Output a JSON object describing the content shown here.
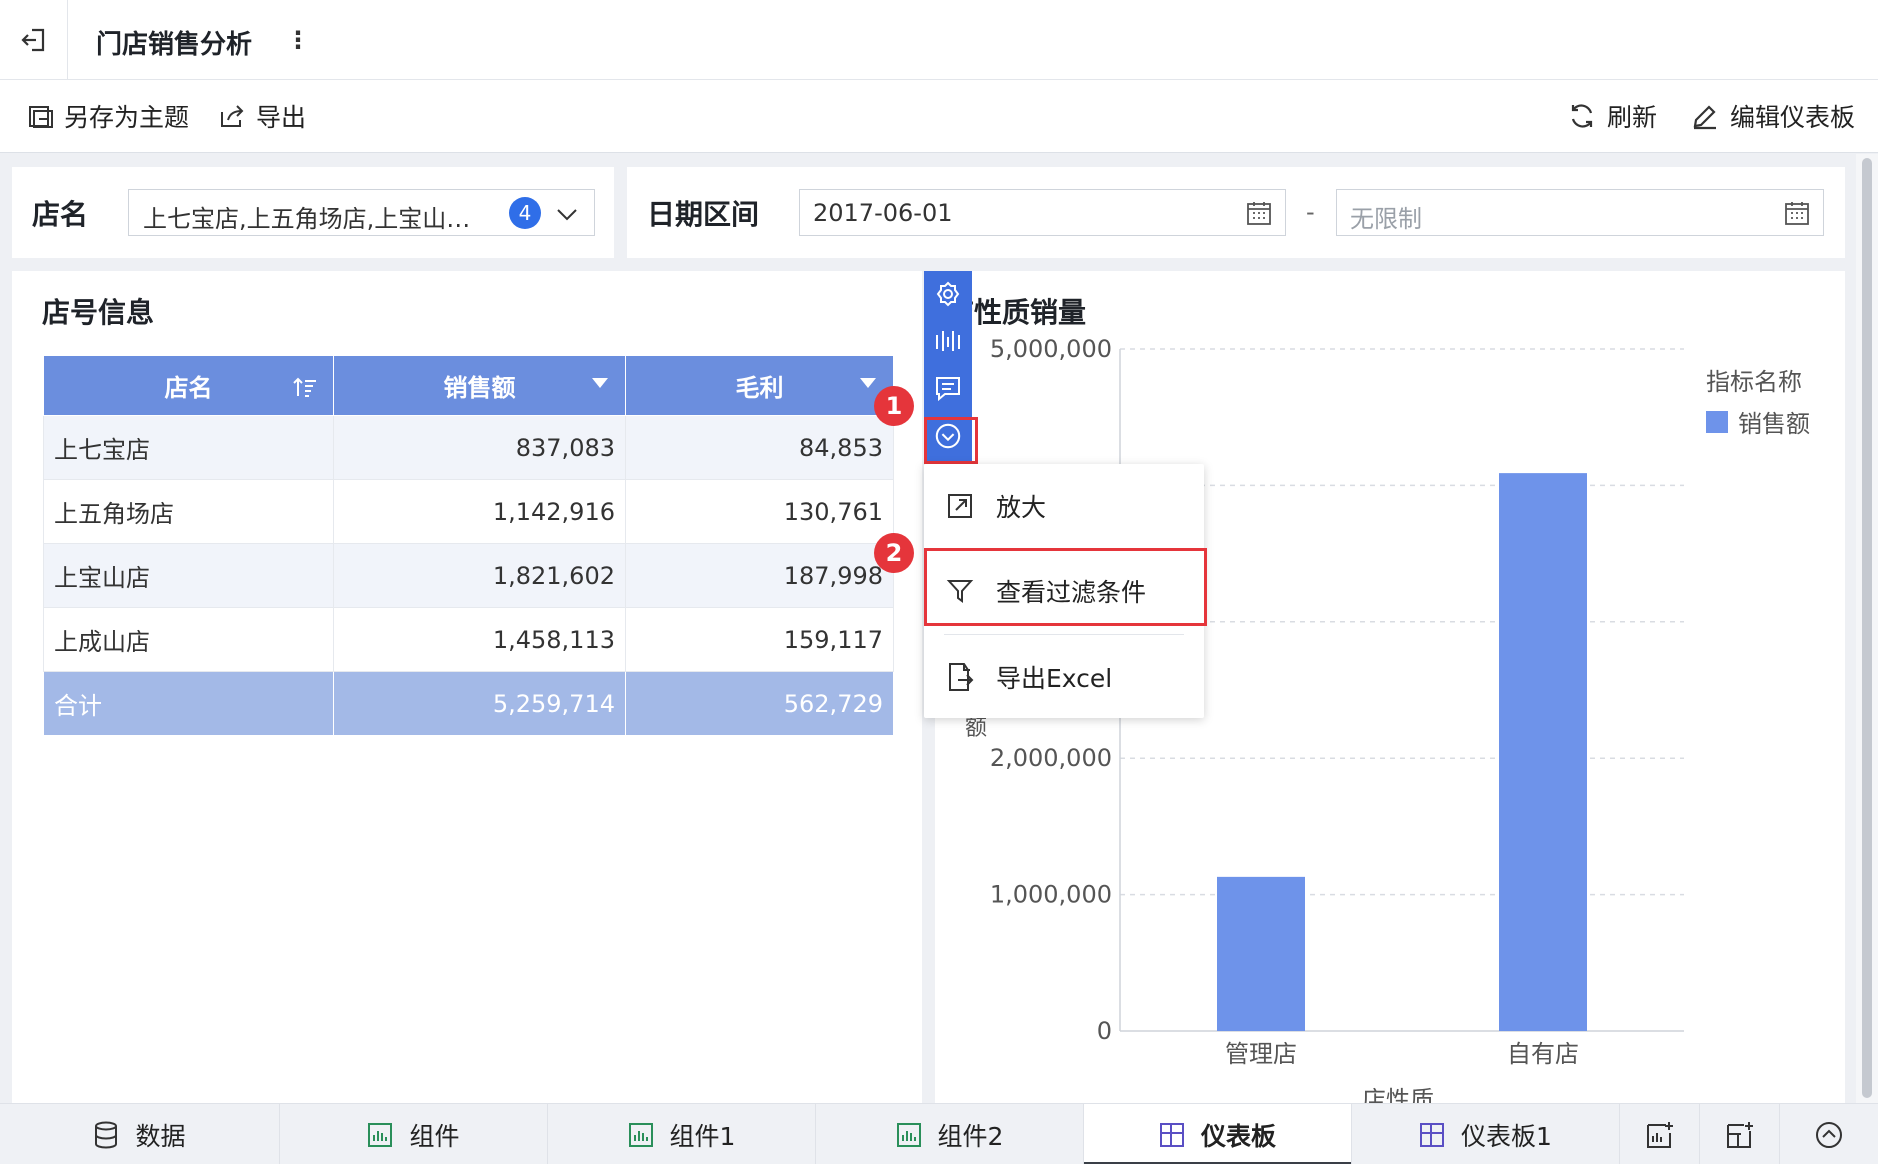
{
  "header": {
    "title": "门店销售分析",
    "more": "⋮"
  },
  "toolbar": {
    "save_as_theme": "另存为主题",
    "export": "导出",
    "refresh": "刷新",
    "edit_dashboard": "编辑仪表板"
  },
  "filters": {
    "store": {
      "label": "店名",
      "value": "上七宝店,上五角场店,上宝山…",
      "count": "4"
    },
    "date": {
      "label": "日期区间",
      "start": "2017-06-01",
      "separator": "-",
      "end_placeholder": "无限制"
    }
  },
  "table_widget": {
    "title": "店号信息",
    "columns": [
      "店名",
      "销售额",
      "毛利"
    ],
    "rows": [
      [
        "上七宝店",
        "837,083",
        "84,853"
      ],
      [
        "上五角场店",
        "1,142,916",
        "130,761"
      ],
      [
        "上宝山店",
        "1,821,602",
        "187,998"
      ],
      [
        "上成山店",
        "1,458,113",
        "159,117"
      ]
    ],
    "total": [
      "合计",
      "5,259,714",
      "562,729"
    ]
  },
  "chart_widget": {
    "title": "店性质销量",
    "title_visible": "店性质销量"
  },
  "chart_data": {
    "type": "bar",
    "categories": [
      "管理店",
      "自有店"
    ],
    "series": [
      {
        "name": "销售额",
        "values": [
          1130000,
          4090000
        ]
      }
    ],
    "yticks": [
      "0",
      "1,000,000",
      "2,000,000",
      "5,000,000"
    ],
    "ylim": [
      0,
      5000000
    ],
    "xlabel": "店性质",
    "ylabel_visible": "额",
    "legend_title": "指标名称",
    "legend_position": "top-right",
    "grid": true,
    "bar_color": "#6e93ea"
  },
  "context_menu": {
    "zoom": "放大",
    "view_filters": "查看过滤条件",
    "export_excel": "导出Excel"
  },
  "markers": {
    "m1": "1",
    "m2": "2"
  },
  "bottom_tabs": [
    {
      "label": "数据"
    },
    {
      "label": "组件"
    },
    {
      "label": "组件1"
    },
    {
      "label": "组件2"
    },
    {
      "label": "仪表板"
    },
    {
      "label": "仪表板1"
    }
  ],
  "colors": {
    "accent": "#3f6fdd",
    "header_blue": "#6b8ede",
    "total_row": "#a3b9e7",
    "highlight_red": "#e5353b"
  }
}
